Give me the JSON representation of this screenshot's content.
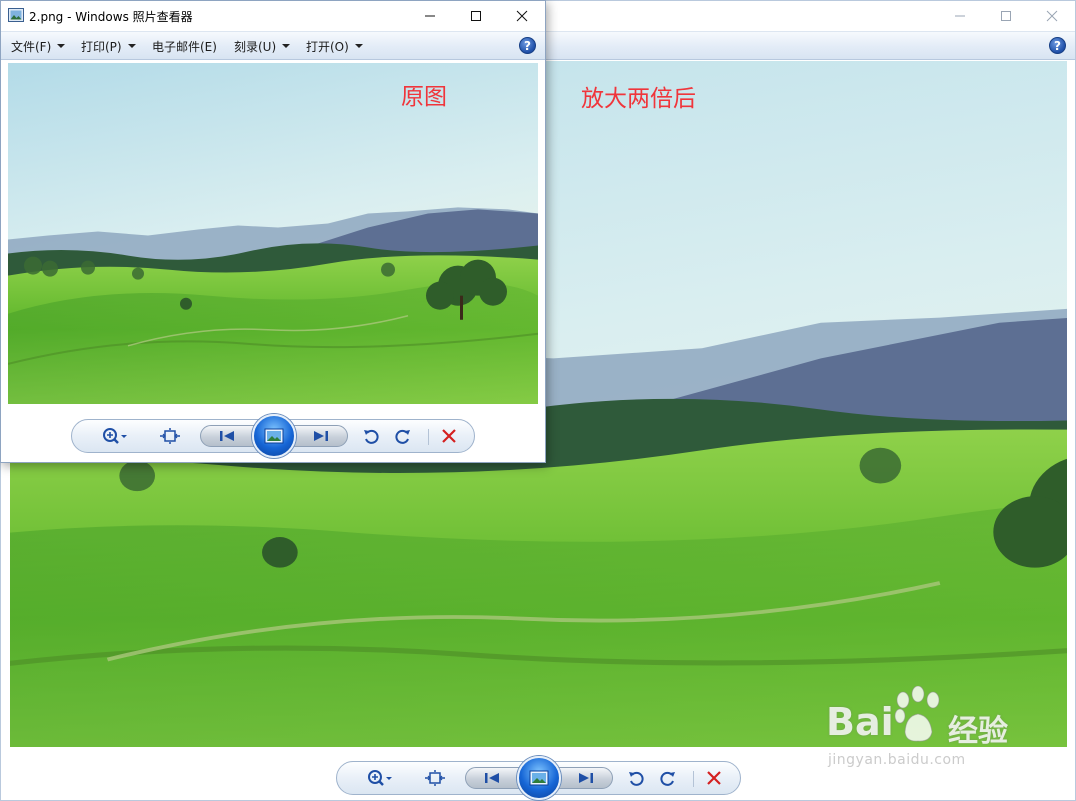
{
  "back_window": {
    "bottom_controls": {}
  },
  "front_window": {
    "title": "2.png - Windows 照片查看器",
    "menu": [
      {
        "label": "文件(F)"
      },
      {
        "label": "打印(P)"
      },
      {
        "label": "电子邮件(E)"
      },
      {
        "label": "刻录(U)"
      },
      {
        "label": "打开(O)"
      }
    ],
    "help_label": "?"
  },
  "annotations": {
    "original_label": "原图",
    "zoomed_label": "放大两倍后",
    "color": "#f0353b"
  },
  "watermark": {
    "brand": "Bai",
    "brand_cn": "经验",
    "url": "jingyan.baidu.com"
  },
  "icons": {
    "zoom": "zoom-in-icon",
    "fit": "fit-window-icon",
    "prev": "previous-icon",
    "slideshow": "slideshow-icon",
    "next": "next-icon",
    "rotate_ccw": "rotate-counterclockwise-icon",
    "rotate_cw": "rotate-clockwise-icon",
    "delete": "delete-icon"
  },
  "colors": {
    "accent_blue": "#1e4fa8",
    "delete_red": "#d42020",
    "menubar": "#e3ecf7"
  }
}
